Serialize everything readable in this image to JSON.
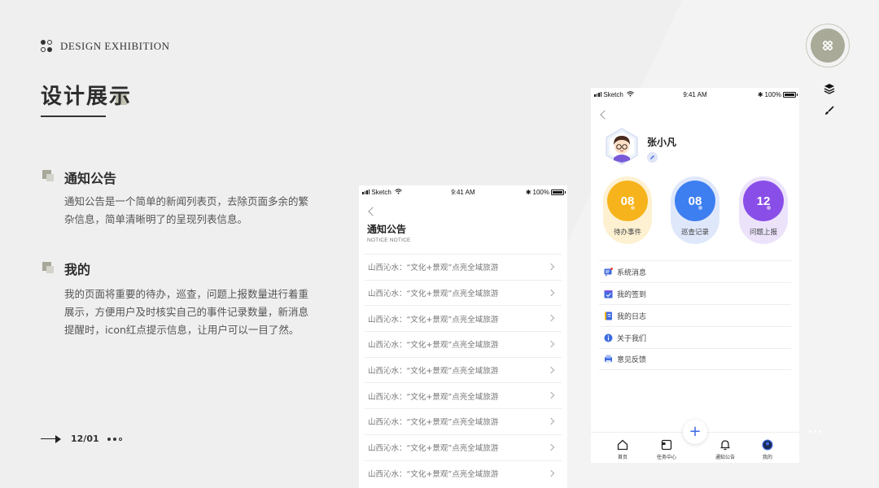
{
  "brand": {
    "text": "DESIGN EXHIBITION"
  },
  "title": "设计展示",
  "sections": [
    {
      "title": "通知公告",
      "desc": "通知公告是一个简单的新闻列表页，去除页面多余的繁杂信息，简单清晰明了的呈现列表信息。"
    },
    {
      "title": "我的",
      "desc": "我的页面将重要的待办，巡查，问题上报数量进行着重展示，方便用户及时核实自己的事件记录数量，新消息提醒时，icon红点提示信息，让用户可以一目了然。"
    }
  ],
  "pager": {
    "page": "12/01"
  },
  "icons": {
    "badge": "tools-icon",
    "tool1": "layers-icon",
    "tool2": "brush-icon"
  },
  "status_bar": {
    "carrier": "Sketch",
    "time": "9:41 AM",
    "battery": "100%"
  },
  "notice_screen": {
    "title": "通知公告",
    "subtitle": "NOTICE NOTICE",
    "items": [
      "山西沁水：“文化+景观”点亮全域旅游",
      "山西沁水：“文化+景观”点亮全域旅游",
      "山西沁水：“文化+景观”点亮全域旅游",
      "山西沁水：“文化+景观”点亮全域旅游",
      "山西沁水：“文化+景观”点亮全域旅游",
      "山西沁水：“文化+景观”点亮全域旅游",
      "山西沁水：“文化+景观”点亮全域旅游",
      "山西沁水：“文化+景观”点亮全域旅游",
      "山西沁水：“文化+景观”点亮全域旅游"
    ]
  },
  "profile_screen": {
    "user_name": "张小凡",
    "stats": [
      {
        "value": "08",
        "label": "待办事件",
        "color": "#f6b31b",
        "bg": "#fdf1d2"
      },
      {
        "value": "08",
        "label": "巡查记录",
        "color": "#3d7ef0",
        "bg": "#dfe8fb"
      },
      {
        "value": "12",
        "label": "问题上报",
        "color": "#8a4ee8",
        "bg": "#ece3fb"
      }
    ],
    "menu": [
      {
        "label": "系统消息",
        "icon": "message-icon"
      },
      {
        "label": "我的签到",
        "icon": "checkin-icon"
      },
      {
        "label": "我的日志",
        "icon": "log-icon"
      },
      {
        "label": "关于我们",
        "icon": "info-icon"
      },
      {
        "label": "意见反馈",
        "icon": "feedback-icon"
      }
    ],
    "tabs": [
      {
        "label": "首页",
        "icon": "home-icon"
      },
      {
        "label": "任务中心",
        "icon": "task-icon"
      },
      {
        "label": "通知公告",
        "icon": "bell-icon"
      },
      {
        "label": "我的",
        "icon": "profile-icon"
      }
    ],
    "plus": "+"
  }
}
